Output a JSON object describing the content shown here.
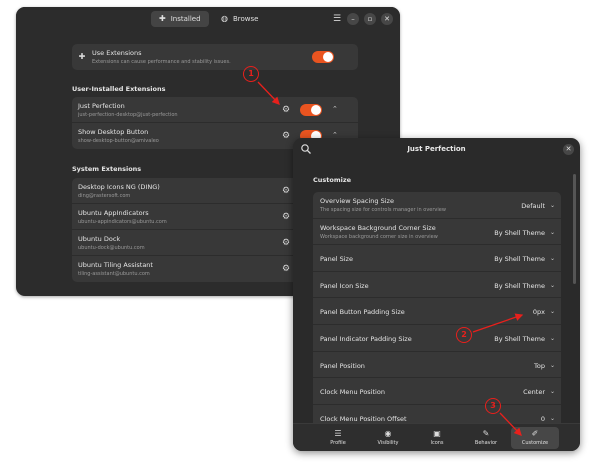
{
  "extensions_window": {
    "tabs": [
      {
        "label": "Installed",
        "icon": "puzzle-icon"
      },
      {
        "label": "Browse",
        "icon": "globe-icon"
      }
    ],
    "use_extensions": {
      "title": "Use Extensions",
      "subtitle": "Extensions can cause performance and stability issues.",
      "enabled": true
    },
    "user_section_title": "User-Installed Extensions",
    "user_extensions": [
      {
        "name": "Just Perfection",
        "uuid": "just-perfection-desktop@just-perfection",
        "enabled": true
      },
      {
        "name": "Show Desktop Button",
        "uuid": "show-desktop-button@amivaleo",
        "enabled": true
      }
    ],
    "system_section_title": "System Extensions",
    "system_extensions": [
      {
        "name": "Desktop Icons NG (DING)",
        "uuid": "ding@rastersoft.com"
      },
      {
        "name": "Ubuntu AppIndicators",
        "uuid": "ubuntu-appindicators@ubuntu.com"
      },
      {
        "name": "Ubuntu Dock",
        "uuid": "ubuntu-dock@ubuntu.com"
      },
      {
        "name": "Ubuntu Tiling Assistant",
        "uuid": "tiling-assistant@ubuntu.com"
      }
    ]
  },
  "jp_window": {
    "title": "Just Perfection",
    "section_title": "Customize",
    "rows": [
      {
        "title": "Overview Spacing Size",
        "subtitle": "The spacing size for controls manager in overview",
        "value": "Default"
      },
      {
        "title": "Workspace Background Corner Size",
        "subtitle": "Workspace background corner size in overview",
        "value": "By Shell Theme"
      },
      {
        "title": "Panel Size",
        "subtitle": "",
        "value": "By Shell Theme"
      },
      {
        "title": "Panel Icon Size",
        "subtitle": "",
        "value": "By Shell Theme"
      },
      {
        "title": "Panel Button Padding Size",
        "subtitle": "",
        "value": "0px"
      },
      {
        "title": "Panel Indicator Padding Size",
        "subtitle": "",
        "value": "By Shell Theme"
      },
      {
        "title": "Panel Position",
        "subtitle": "",
        "value": "Top"
      },
      {
        "title": "Clock Menu Position",
        "subtitle": "",
        "value": "Center"
      },
      {
        "title": "Clock Menu Position Offset",
        "subtitle": "",
        "value": "0"
      }
    ],
    "nav": [
      {
        "label": "Profile",
        "icon": "profile-icon"
      },
      {
        "label": "Visibility",
        "icon": "visibility-icon"
      },
      {
        "label": "Icons",
        "icon": "image-icon"
      },
      {
        "label": "Behavior",
        "icon": "wrench-icon"
      },
      {
        "label": "Customize",
        "icon": "brush-icon"
      }
    ],
    "active_nav": "Customize"
  },
  "annotations": [
    "1",
    "2",
    "3"
  ],
  "colors": {
    "accent": "#e95420",
    "annotation": "#e8201c",
    "window_bg": "#2c2c2c",
    "row_bg": "#383838"
  }
}
